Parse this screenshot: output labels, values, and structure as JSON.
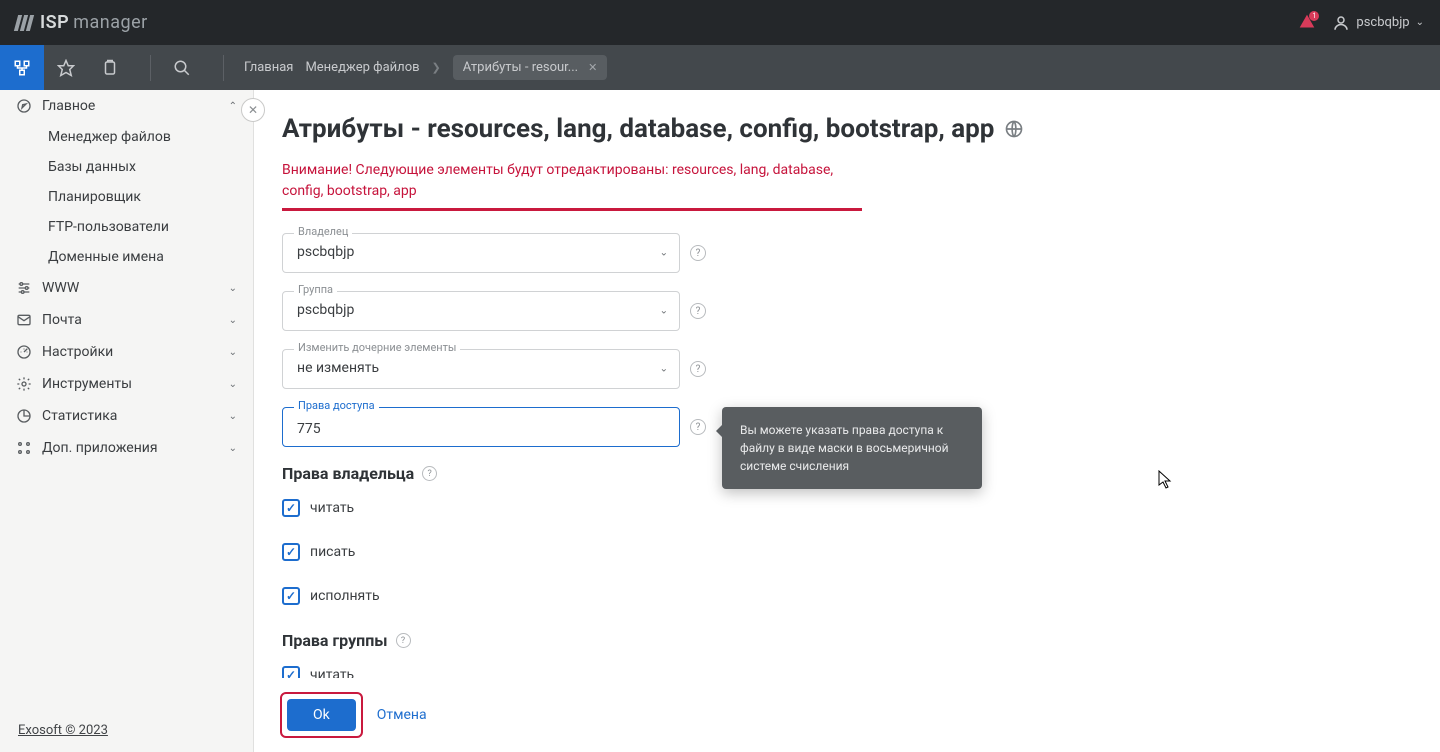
{
  "logo": {
    "prefix": "ISP",
    "suffix": "manager"
  },
  "topbar": {
    "username": "pscbqbjp",
    "bell_count": "1"
  },
  "breadcrumb": {
    "home": "Главная",
    "fm": "Менеджер файлов",
    "tab": "Атрибуты - resour...",
    "tab_close": "✕"
  },
  "sidebar": {
    "items": [
      {
        "label": "Главное",
        "icon": "compass",
        "open": true,
        "children": [
          {
            "label": "Менеджер файлов"
          },
          {
            "label": "Базы данных"
          },
          {
            "label": "Планировщик"
          },
          {
            "label": "FTP-пользователи"
          },
          {
            "label": "Доменные имена"
          }
        ]
      },
      {
        "label": "WWW",
        "icon": "sliders",
        "open": false
      },
      {
        "label": "Почта",
        "icon": "mail",
        "open": false
      },
      {
        "label": "Настройки",
        "icon": "gauge",
        "open": false
      },
      {
        "label": "Инструменты",
        "icon": "gear",
        "open": false
      },
      {
        "label": "Статистика",
        "icon": "pie",
        "open": false
      },
      {
        "label": "Доп. приложения",
        "icon": "apps",
        "open": false
      }
    ],
    "footer": "Exosoft © 2023"
  },
  "page": {
    "title": "Атрибуты - resources, lang, database, config, bootstrap, app",
    "warning": "Внимание! Следующие элементы будут отредактированы: resources, lang, database, config, bootstrap, app",
    "fields": {
      "owner_label": "Владелец",
      "owner_value": "pscbqbjp",
      "group_label": "Группа",
      "group_value": "pscbqbjp",
      "recursive_label": "Изменить дочерние элементы",
      "recursive_value": "не изменять",
      "perms_label": "Права доступа",
      "perms_value": "775"
    },
    "tooltip": "Вы можете указать права доступа к файлу в виде маски в восьмеричной системе счисления",
    "owner_section": "Права владельца",
    "group_section": "Права группы",
    "checks": {
      "read": "читать",
      "write": "писать",
      "exec": "исполнять",
      "g_read": "читать"
    },
    "ok": "Ok",
    "cancel": "Отмена"
  }
}
